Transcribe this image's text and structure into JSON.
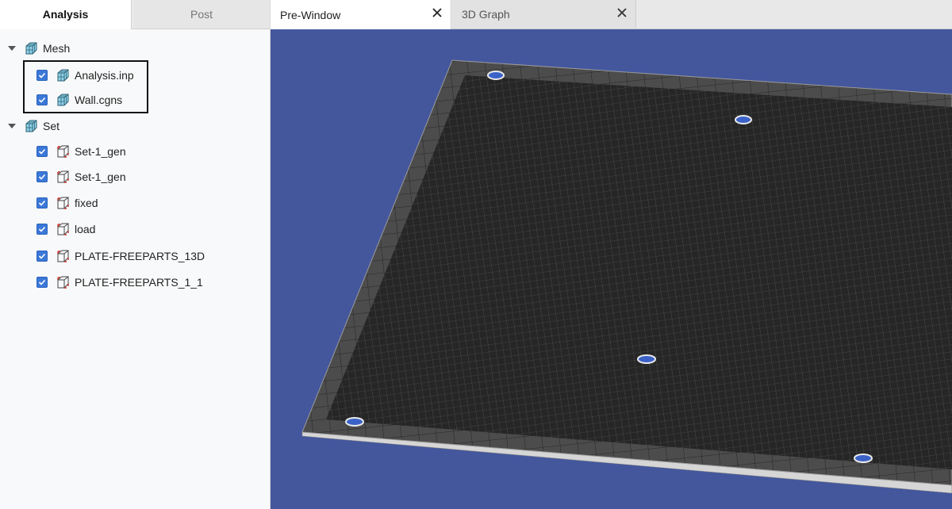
{
  "left_tabs": {
    "analysis": "Analysis",
    "post": "Post"
  },
  "tree": {
    "mesh": {
      "label": "Mesh",
      "children": [
        "Analysis.inp",
        "Wall.cgns"
      ]
    },
    "set": {
      "label": "Set",
      "children": [
        "Set-1_gen",
        "Set-1_gen",
        "fixed",
        "load",
        "PLATE-FREEPARTS_13D",
        "PLATE-FREEPARTS_1_1"
      ]
    }
  },
  "right_tabs": {
    "pre_window": "Pre-Window",
    "graph_3d": "3D Graph"
  },
  "colors": {
    "viewport_bg": "#44579d",
    "checkbox": "#3b78d8",
    "mesh_dark": "#2a2a2a",
    "plate_edge": "#c8c8c8"
  },
  "icons": {
    "mesh": "mesh-cube-icon",
    "set": "set-cube-icon",
    "close": "close-icon",
    "expand": "caret-down-icon",
    "check": "checkbox-checked-icon"
  }
}
